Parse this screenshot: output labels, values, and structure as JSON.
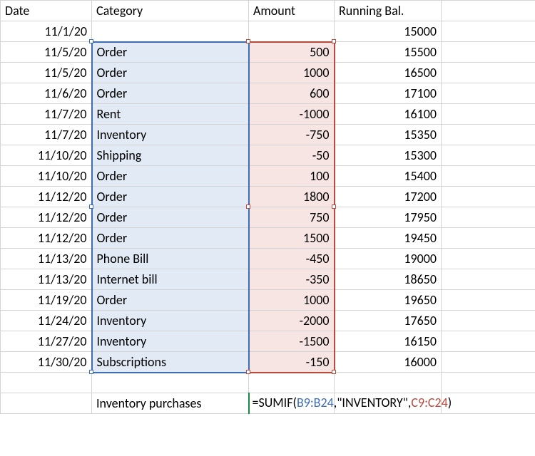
{
  "headers": {
    "date": "Date",
    "category": "Category",
    "amount": "Amount",
    "running": "Running Bal."
  },
  "rows": [
    {
      "date": "11/1/20",
      "category": "",
      "amount": "",
      "bal": "15000"
    },
    {
      "date": "11/5/20",
      "category": "Order",
      "amount": "500",
      "bal": "15500"
    },
    {
      "date": "11/5/20",
      "category": "Order",
      "amount": "1000",
      "bal": "16500"
    },
    {
      "date": "11/6/20",
      "category": "Order",
      "amount": "600",
      "bal": "17100"
    },
    {
      "date": "11/7/20",
      "category": "Rent",
      "amount": "-1000",
      "bal": "16100"
    },
    {
      "date": "11/7/20",
      "category": "Inventory",
      "amount": "-750",
      "bal": "15350"
    },
    {
      "date": "11/10/20",
      "category": "Shipping",
      "amount": "-50",
      "bal": "15300"
    },
    {
      "date": "11/10/20",
      "category": "Order",
      "amount": "100",
      "bal": "15400"
    },
    {
      "date": "11/12/20",
      "category": "Order",
      "amount": "1800",
      "bal": "17200"
    },
    {
      "date": "11/12/20",
      "category": "Order",
      "amount": "750",
      "bal": "17950"
    },
    {
      "date": "11/12/20",
      "category": "Order",
      "amount": "1500",
      "bal": "19450"
    },
    {
      "date": "11/13/20",
      "category": "Phone Bill",
      "amount": "-450",
      "bal": "19000"
    },
    {
      "date": "11/13/20",
      "category": "Internet bill",
      "amount": "-350",
      "bal": "18650"
    },
    {
      "date": "11/19/20",
      "category": "Order",
      "amount": "1000",
      "bal": "19650"
    },
    {
      "date": "11/24/20",
      "category": "Inventory",
      "amount": "-2000",
      "bal": "17650"
    },
    {
      "date": "11/27/20",
      "category": "Inventory",
      "amount": "-1500",
      "bal": "16150"
    },
    {
      "date": "11/30/20",
      "category": "Subscriptions",
      "amount": "-150",
      "bal": "16000"
    }
  ],
  "summary": {
    "label": "Inventory purchases",
    "formula_prefix": "=SUMIF(",
    "formula_range1": "B9:B24",
    "formula_mid": ",\"INVENTORY\",",
    "formula_range2": "C9:C24",
    "formula_suffix": ")"
  }
}
